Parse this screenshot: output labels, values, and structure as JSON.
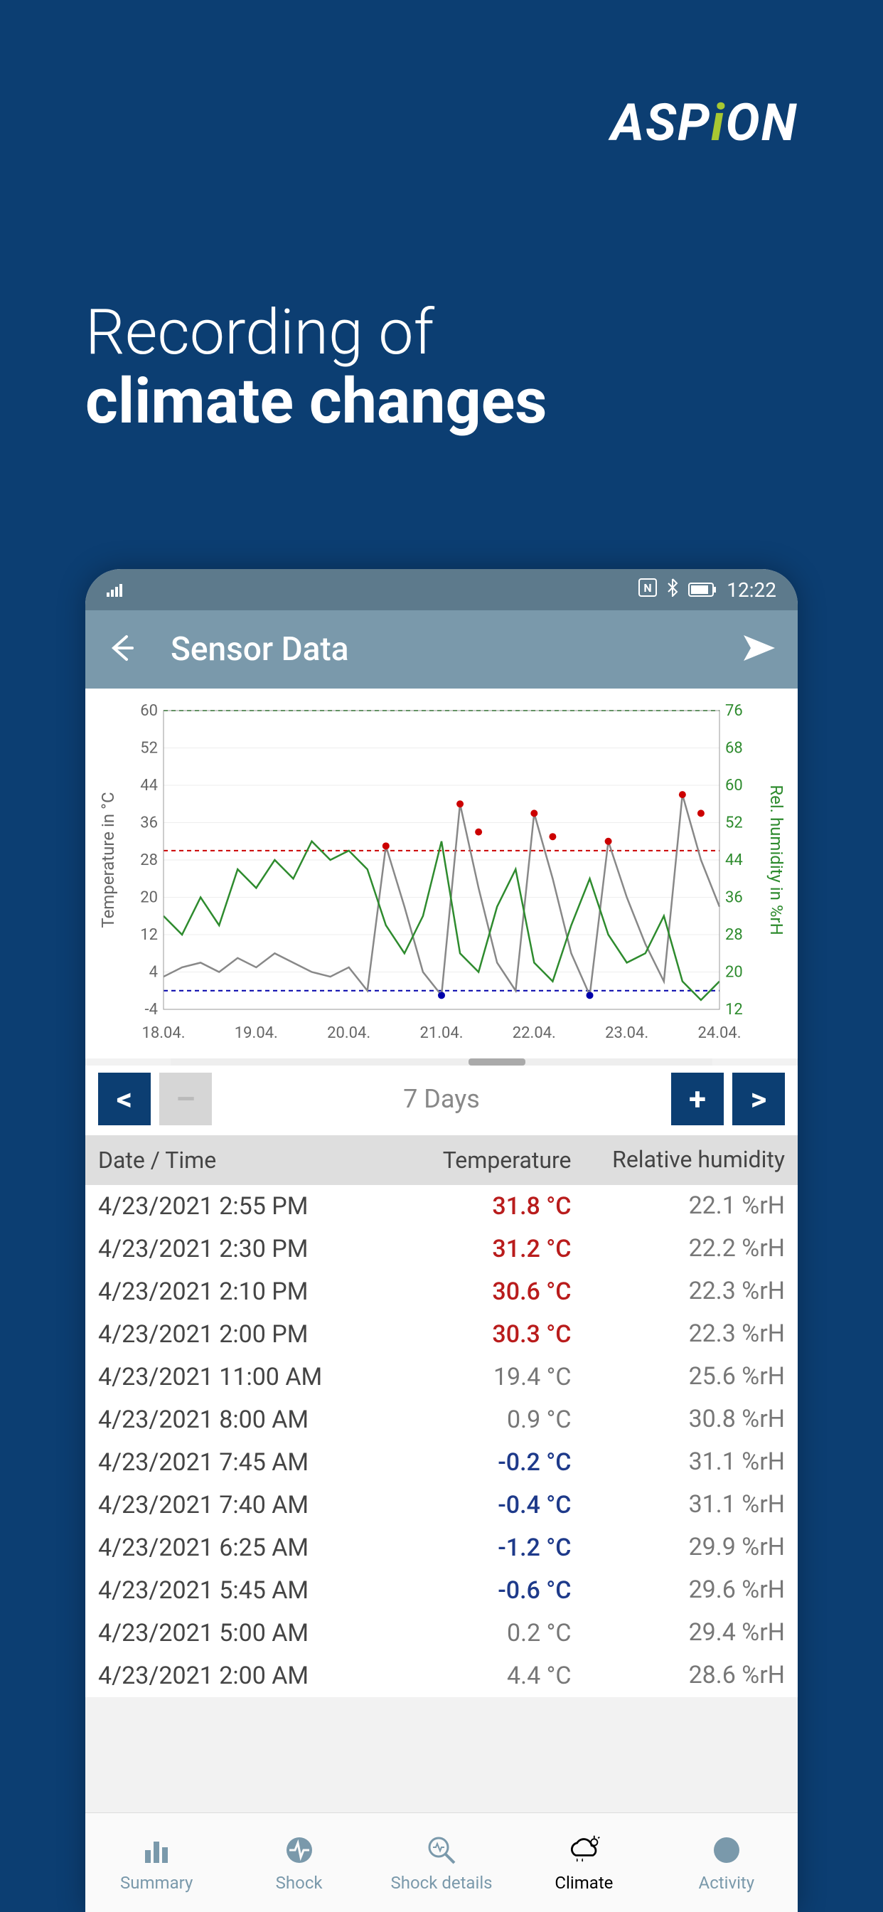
{
  "brand": "ASPION",
  "headline_line1": "Recording of",
  "headline_line2": "climate changes",
  "status": {
    "time": "12:22"
  },
  "appbar": {
    "title": "Sensor Data"
  },
  "chart_data": {
    "type": "line",
    "xlabel_ticks": [
      "18.04.",
      "19.04.",
      "20.04.",
      "21.04.",
      "22.04.",
      "23.04.",
      "24.04."
    ],
    "left_axis": {
      "label": "Temperature in °C",
      "min": -4,
      "max": 60,
      "ticks": [
        -4,
        4,
        12,
        20,
        28,
        36,
        44,
        52,
        60
      ]
    },
    "right_axis": {
      "label": "Rel. humidity in %rH",
      "min": 12,
      "max": 76,
      "ticks": [
        12,
        20,
        28,
        36,
        44,
        52,
        60,
        68,
        76
      ]
    },
    "thresholds": {
      "temp_high": 30,
      "temp_low": 0,
      "humidity_high": 76
    },
    "series": [
      {
        "name": "Temperature",
        "axis": "left",
        "color": "#888888",
        "points": [
          3,
          5,
          6,
          4,
          7,
          5,
          8,
          6,
          4,
          3,
          5,
          0,
          31,
          18,
          4,
          -1,
          40,
          22,
          6,
          0,
          38,
          24,
          8,
          -1,
          32,
          20,
          10,
          2,
          42,
          28,
          18
        ]
      },
      {
        "name": "TempExceedHigh",
        "axis": "left",
        "color": "#cc0000",
        "markers": [
          {
            "x": 12,
            "y": 31
          },
          {
            "x": 16,
            "y": 40
          },
          {
            "x": 17,
            "y": 34
          },
          {
            "x": 20,
            "y": 38
          },
          {
            "x": 21,
            "y": 33
          },
          {
            "x": 24,
            "y": 32
          },
          {
            "x": 28,
            "y": 42
          },
          {
            "x": 29,
            "y": 38
          }
        ]
      },
      {
        "name": "TempExceedLow",
        "axis": "left",
        "color": "#0000aa",
        "markers": [
          {
            "x": 15,
            "y": -1
          },
          {
            "x": 23,
            "y": -1
          }
        ]
      },
      {
        "name": "Humidity",
        "axis": "right",
        "color": "#2e8b2e",
        "points": [
          32,
          28,
          36,
          30,
          42,
          38,
          44,
          40,
          48,
          44,
          46,
          42,
          30,
          24,
          32,
          48,
          24,
          20,
          34,
          42,
          22,
          18,
          30,
          40,
          28,
          22,
          24,
          32,
          18,
          14,
          18
        ]
      }
    ]
  },
  "controls": {
    "range_label": "7 Days",
    "prev": "<",
    "next": ">",
    "minus": "–",
    "plus": "+"
  },
  "table": {
    "headers": {
      "datetime": "Date / Time",
      "temperature": "Temperature",
      "humidity": "Relative humidity"
    },
    "rows": [
      {
        "dt": "4/23/2021 2:55 PM",
        "temp": "31.8 °C",
        "temp_class": "red",
        "hum": "22.1 %rH"
      },
      {
        "dt": "4/23/2021 2:30 PM",
        "temp": "31.2 °C",
        "temp_class": "red",
        "hum": "22.2 %rH"
      },
      {
        "dt": "4/23/2021 2:10 PM",
        "temp": "30.6 °C",
        "temp_class": "red",
        "hum": "22.3 %rH"
      },
      {
        "dt": "4/23/2021 2:00 PM",
        "temp": "30.3 °C",
        "temp_class": "red",
        "hum": "22.3 %rH"
      },
      {
        "dt": "4/23/2021 11:00 AM",
        "temp": "19.4 °C",
        "temp_class": "gray",
        "hum": "25.6 %rH"
      },
      {
        "dt": "4/23/2021 8:00 AM",
        "temp": "0.9 °C",
        "temp_class": "gray",
        "hum": "30.8 %rH"
      },
      {
        "dt": "4/23/2021 7:45 AM",
        "temp": "-0.2 °C",
        "temp_class": "blue",
        "hum": "31.1 %rH"
      },
      {
        "dt": "4/23/2021 7:40 AM",
        "temp": "-0.4 °C",
        "temp_class": "blue",
        "hum": "31.1 %rH"
      },
      {
        "dt": "4/23/2021 6:25 AM",
        "temp": "-1.2 °C",
        "temp_class": "blue",
        "hum": "29.9 %rH"
      },
      {
        "dt": "4/23/2021 5:45 AM",
        "temp": "-0.6 °C",
        "temp_class": "blue",
        "hum": "29.6 %rH"
      },
      {
        "dt": "4/23/2021 5:00 AM",
        "temp": "0.2 °C",
        "temp_class": "gray",
        "hum": "29.4 %rH"
      },
      {
        "dt": "4/23/2021 2:00 AM",
        "temp": "4.4 °C",
        "temp_class": "gray",
        "hum": "28.6 %rH"
      }
    ]
  },
  "nav": {
    "items": [
      {
        "label": "Summary",
        "icon": "bar-chart-icon",
        "active": false
      },
      {
        "label": "Shock",
        "icon": "shock-icon",
        "active": false
      },
      {
        "label": "Shock details",
        "icon": "search-shock-icon",
        "active": false
      },
      {
        "label": "Climate",
        "icon": "cloud-icon",
        "active": true
      },
      {
        "label": "Activity",
        "icon": "circle-icon",
        "active": false
      }
    ]
  }
}
